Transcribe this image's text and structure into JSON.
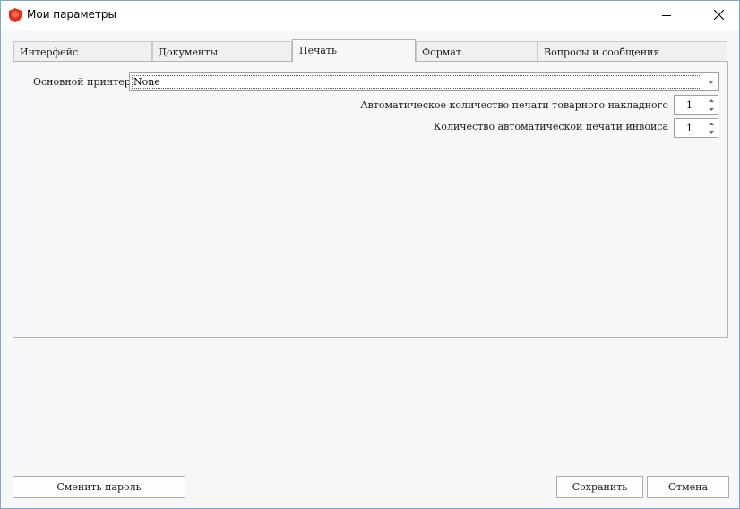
{
  "window": {
    "title": "Мои параметры",
    "icon": "shield-logo-icon",
    "accent": "#e0311c"
  },
  "tabs": [
    {
      "label": "Интерфейс",
      "active": false
    },
    {
      "label": "Документы",
      "active": false
    },
    {
      "label": "Печать",
      "active": true
    },
    {
      "label": "Формат",
      "active": false
    },
    {
      "label": "Вопросы и сообщения",
      "active": false
    }
  ],
  "print": {
    "printer_label": "Основной принтер",
    "printer_value": "None",
    "goods_invoice_copies_label": "Автоматическое количество печати товарного накладного",
    "goods_invoice_copies_value": "1",
    "invoice_copies_label": "Количество автоматической печати инвойса",
    "invoice_copies_value": "1"
  },
  "footer": {
    "change_password_label": "Сменить пароль",
    "save_label": "Сохранить",
    "cancel_label": "Отмена"
  }
}
